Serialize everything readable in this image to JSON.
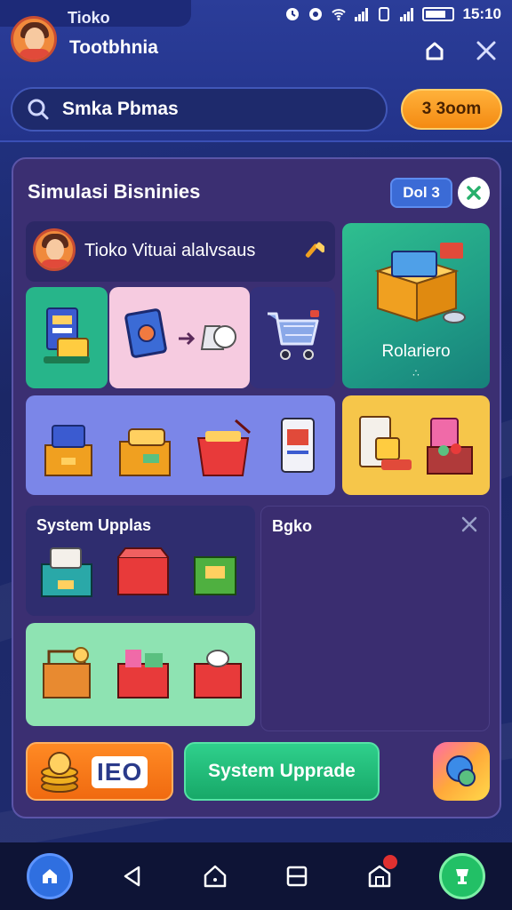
{
  "status_bar": {
    "time": "15:10"
  },
  "header": {
    "app_name": "Tioko",
    "app_subtitle": "Tootbhnia",
    "search_value": "Smka Pbmas",
    "coin_button": "3 3oom"
  },
  "panel": {
    "title": "Simulasi Bisninies",
    "level_badge": "Dol 3",
    "store_name": "Tioko Vituai alalvsaus",
    "big_tile_label": "Rolariero",
    "big_tile_sub": "∴",
    "upgrades_label": "System Upplas",
    "info_label": "Bgko",
    "coin_card_label": "IEO",
    "upgrade_button": "System Upprade"
  },
  "colors": {
    "accent_orange": "#f48a12",
    "accent_green": "#17a868",
    "panel_bg": "#3b2f72",
    "header_bg": "#2b3d99"
  },
  "icons": [
    "search-icon",
    "close-icon",
    "home-outline-icon",
    "shopping-cart-icon",
    "box-icon",
    "back-icon",
    "recents-icon",
    "store-icon"
  ]
}
